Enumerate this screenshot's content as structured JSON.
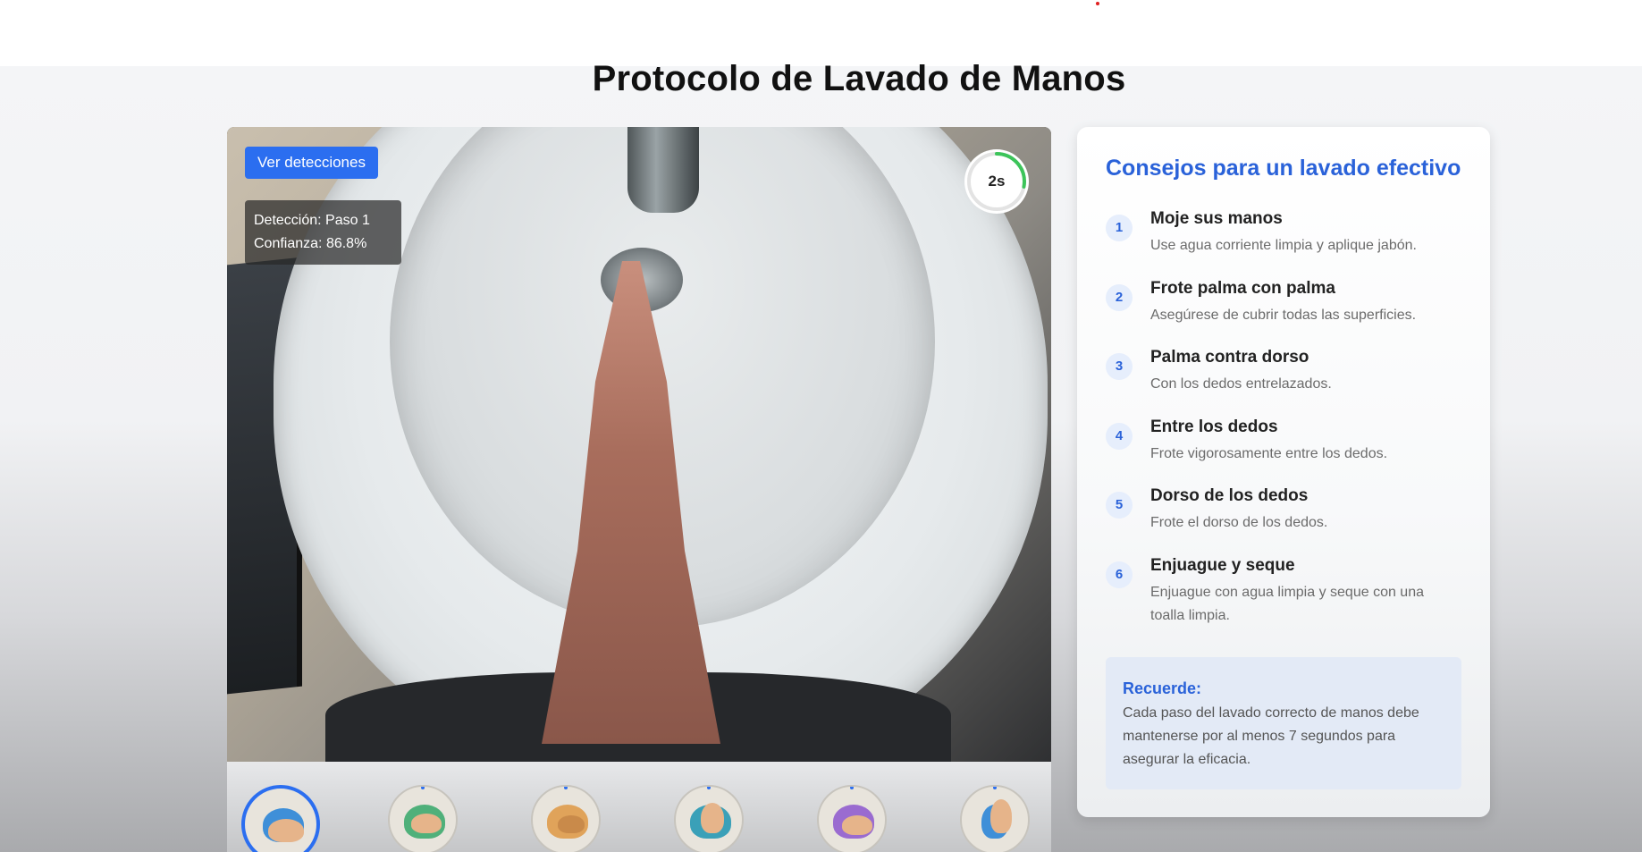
{
  "page": {
    "title": "Protocolo de Lavado de Manos"
  },
  "camera": {
    "detections_button": "Ver detecciones",
    "detection_label": "Detección: Paso 1",
    "confidence_label": "Confianza: 86.8%",
    "timer_text": "2s",
    "timer_progress": 0.28
  },
  "steps": [
    {
      "icon": "palm-to-palm-icon",
      "active": true
    },
    {
      "icon": "palm-over-back-icon",
      "active": false
    },
    {
      "icon": "fingers-interlaced-icon",
      "active": false
    },
    {
      "icon": "thumb-rotation-icon",
      "active": false
    },
    {
      "icon": "back-of-fingers-icon",
      "active": false
    },
    {
      "icon": "fingertips-icon",
      "active": false
    }
  ],
  "tips": {
    "title": "Consejos para un lavado efectivo",
    "items": [
      {
        "num": "1",
        "title": "Moje sus manos",
        "desc": "Use agua corriente limpia y aplique jabón."
      },
      {
        "num": "2",
        "title": "Frote palma con palma",
        "desc": "Asegúrese de cubrir todas las superficies."
      },
      {
        "num": "3",
        "title": "Palma contra dorso",
        "desc": "Con los dedos entrelazados."
      },
      {
        "num": "4",
        "title": "Entre los dedos",
        "desc": "Frote vigorosamente entre los dedos."
      },
      {
        "num": "5",
        "title": "Dorso de los dedos",
        "desc": "Frote el dorso de los dedos."
      },
      {
        "num": "6",
        "title": "Enjuague y seque",
        "desc": "Enjuague con agua limpia y seque con una toalla limpia."
      }
    ],
    "remember_title": "Recuerde:",
    "remember_text": "Cada paso del lavado correcto de manos debe mantenerse por al menos 7 segundos para asegurar la eficacia."
  },
  "colors": {
    "accent": "#2b6ef0",
    "title_blue": "#2a62d9",
    "remember_bg": "#e3eaf6"
  }
}
